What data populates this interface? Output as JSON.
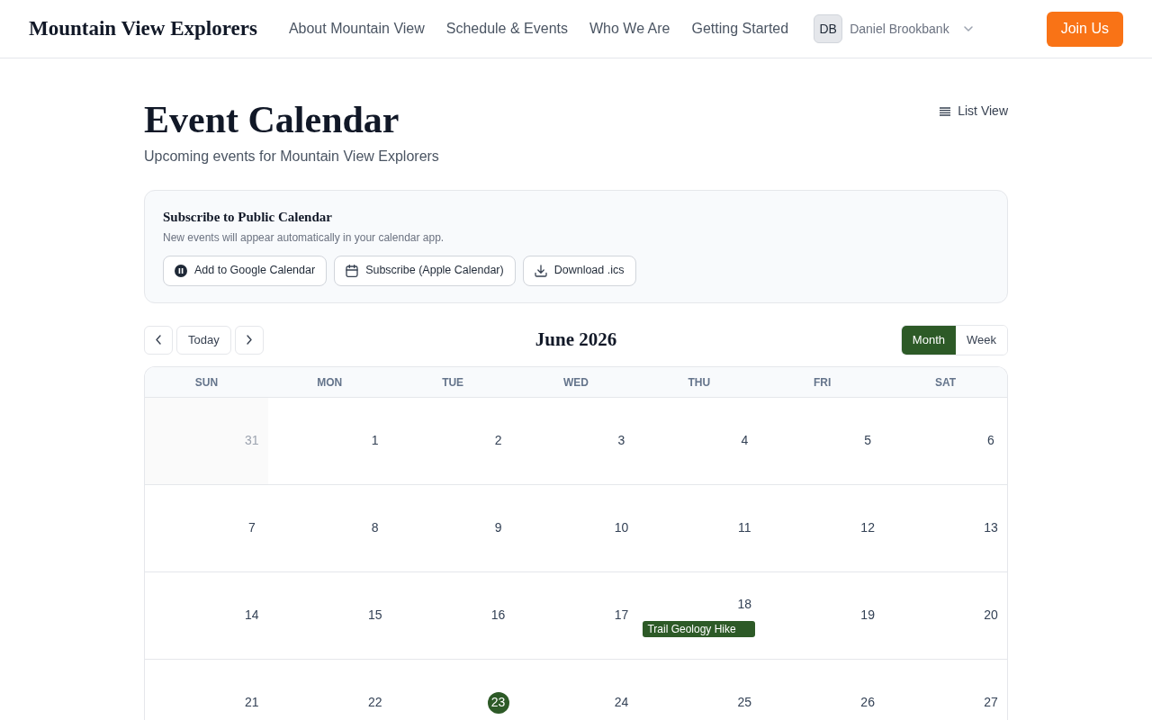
{
  "header": {
    "logo": "Mountain View Explorers",
    "nav": [
      "About Mountain View",
      "Schedule & Events",
      "Who We Are",
      "Getting Started"
    ],
    "user": {
      "initials": "DB",
      "name": "Daniel Brookbank"
    },
    "cta": "Join Us"
  },
  "page": {
    "title": "Event Calendar",
    "subtitle": "Upcoming events for Mountain View Explorers",
    "list_view": "List View"
  },
  "subscribe": {
    "title": "Subscribe to Public Calendar",
    "description": "New events will appear automatically in your calendar app.",
    "buttons": [
      {
        "kind": "google",
        "label": "Add to Google Calendar"
      },
      {
        "kind": "apple",
        "label": "Subscribe (Apple Calendar)"
      },
      {
        "kind": "download",
        "label": "Download .ics"
      }
    ]
  },
  "calendar": {
    "today_button": "Today",
    "month_title": "June 2026",
    "views": [
      {
        "label": "Month",
        "selected": true
      },
      {
        "label": "Week",
        "selected": false
      }
    ],
    "weekdays": [
      "SUN",
      "MON",
      "TUE",
      "WED",
      "THU",
      "FRI",
      "SAT"
    ],
    "weeks": [
      [
        {
          "day": "31",
          "outside": true,
          "today": false
        },
        {
          "day": "1",
          "outside": false,
          "today": false
        },
        {
          "day": "2",
          "outside": false,
          "today": false
        },
        {
          "day": "3",
          "outside": false,
          "today": false
        },
        {
          "day": "4",
          "outside": false,
          "today": false
        },
        {
          "day": "5",
          "outside": false,
          "today": false
        },
        {
          "day": "6",
          "outside": false,
          "today": false
        }
      ],
      [
        {
          "day": "7",
          "outside": false,
          "today": false
        },
        {
          "day": "8",
          "outside": false,
          "today": false
        },
        {
          "day": "9",
          "outside": false,
          "today": false
        },
        {
          "day": "10",
          "outside": false,
          "today": false
        },
        {
          "day": "11",
          "outside": false,
          "today": false
        },
        {
          "day": "12",
          "outside": false,
          "today": false
        },
        {
          "day": "13",
          "outside": false,
          "today": false
        }
      ],
      [
        {
          "day": "14",
          "outside": false,
          "today": false
        },
        {
          "day": "15",
          "outside": false,
          "today": false
        },
        {
          "day": "16",
          "outside": false,
          "today": false
        },
        {
          "day": "17",
          "outside": false,
          "today": false
        },
        {
          "day": "18",
          "outside": false,
          "today": false,
          "events": [
            {
              "title": "Trail Geology Hike"
            }
          ]
        },
        {
          "day": "19",
          "outside": false,
          "today": false
        },
        {
          "day": "20",
          "outside": false,
          "today": false
        }
      ],
      [
        {
          "day": "21",
          "outside": false,
          "today": false
        },
        {
          "day": "22",
          "outside": false,
          "today": false
        },
        {
          "day": "23",
          "outside": false,
          "today": true
        },
        {
          "day": "24",
          "outside": false,
          "today": false
        },
        {
          "day": "25",
          "outside": false,
          "today": false
        },
        {
          "day": "26",
          "outside": false,
          "today": false
        },
        {
          "day": "27",
          "outside": false,
          "today": false
        }
      ]
    ]
  }
}
